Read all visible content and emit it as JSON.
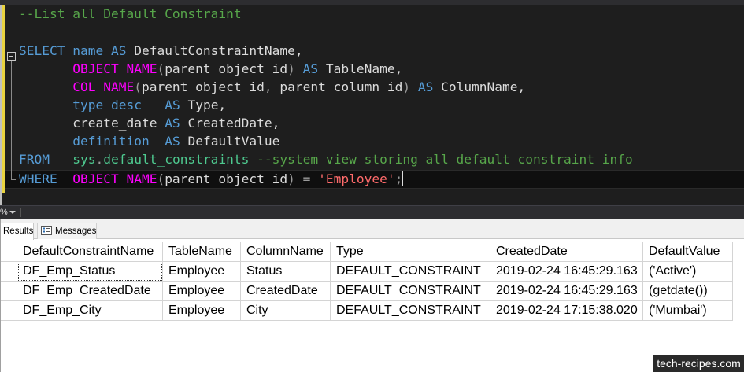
{
  "editor": {
    "line_comment": "--List all Default Constraint",
    "tokens": {
      "select_kw": "SELECT",
      "name_col": "name",
      "as_kw": "AS",
      "alias_default_constraint_name": "DefaultConstraintName,",
      "object_name_fn": "OBJECT_NAME",
      "paren_open": "(",
      "parent_object_id": "parent_object_id",
      "paren_close": ")",
      "alias_table_name": "TableName,",
      "col_name_fn": "COL_NAME",
      "comma_sep": ",",
      "parent_column_id": "parent_column_id",
      "alias_column_name": "ColumnName,",
      "type_desc_col": "type_desc",
      "alias_type": "Type,",
      "create_date_col": "create_date",
      "alias_created_date": "CreatedDate,",
      "definition_col": "definition",
      "alias_default_value": "DefaultValue",
      "from_kw": "FROM",
      "sys_schema": "sys",
      "dot": ".",
      "default_constraints_view": "default_constraints",
      "inline_comment": "--system view storing all default constraint info",
      "where_kw": "WHERE",
      "equals_op": "=",
      "employee_literal": "'Employee'",
      "semicolon": ";"
    }
  },
  "zoom": {
    "value": "%"
  },
  "results_tabs": {
    "results_label": "Results",
    "messages_label": "Messages"
  },
  "grid": {
    "columns": [
      "DefaultConstraintName",
      "TableName",
      "ColumnName",
      "Type",
      "CreatedDate",
      "DefaultValue"
    ],
    "rows": [
      [
        "DF_Emp_Status",
        "Employee",
        "Status",
        "DEFAULT_CONSTRAINT",
        "2019-02-24 16:45:29.163",
        "('Active')"
      ],
      [
        "DF_Emp_CreatedDate",
        "Employee",
        "CreatedDate",
        "DEFAULT_CONSTRAINT",
        "2019-02-24 16:45:29.163",
        "(getdate())"
      ],
      [
        "DF_Emp_City",
        "Employee",
        "City",
        "DEFAULT_CONSTRAINT",
        "2019-02-24 17:15:38.020",
        "('Mumbai')"
      ]
    ]
  },
  "watermark": {
    "text": "tech-recipes.com"
  },
  "colors": {
    "editor_bg": "#1e1e1e",
    "keyword": "#569cd6",
    "function": "#ff00ff",
    "string": "#ff6b6b",
    "comment": "#57a64a",
    "system_object": "#4ec98f"
  }
}
